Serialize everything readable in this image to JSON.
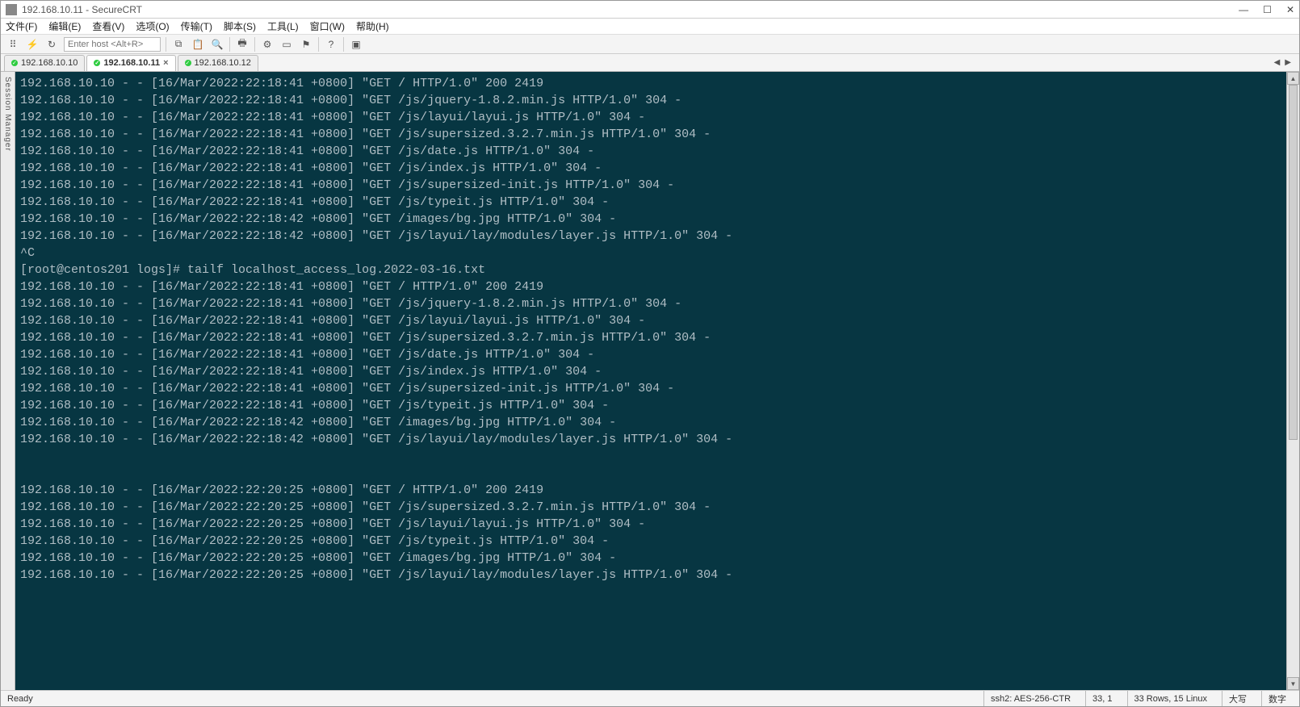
{
  "window": {
    "title": "192.168.10.11 - SecureCRT"
  },
  "menu": {
    "file": "文件(F)",
    "edit": "编辑(E)",
    "view": "查看(V)",
    "options": "选项(O)",
    "transfer": "传输(T)",
    "script": "脚本(S)",
    "tools": "工具(L)",
    "window": "窗口(W)",
    "help": "帮助(H)"
  },
  "toolbar": {
    "host_placeholder": "Enter host <Alt+R>"
  },
  "side_rail": {
    "label": "Session Manager"
  },
  "tabs": [
    {
      "label": "192.168.10.10",
      "active": false,
      "closeable": false
    },
    {
      "label": "192.168.10.11",
      "active": true,
      "closeable": true
    },
    {
      "label": "192.168.10.12",
      "active": false,
      "closeable": false
    }
  ],
  "terminal_lines": [
    "192.168.10.10 - - [16/Mar/2022:22:18:41 +0800] \"GET / HTTP/1.0\" 200 2419",
    "192.168.10.10 - - [16/Mar/2022:22:18:41 +0800] \"GET /js/jquery-1.8.2.min.js HTTP/1.0\" 304 -",
    "192.168.10.10 - - [16/Mar/2022:22:18:41 +0800] \"GET /js/layui/layui.js HTTP/1.0\" 304 -",
    "192.168.10.10 - - [16/Mar/2022:22:18:41 +0800] \"GET /js/supersized.3.2.7.min.js HTTP/1.0\" 304 -",
    "192.168.10.10 - - [16/Mar/2022:22:18:41 +0800] \"GET /js/date.js HTTP/1.0\" 304 -",
    "192.168.10.10 - - [16/Mar/2022:22:18:41 +0800] \"GET /js/index.js HTTP/1.0\" 304 -",
    "192.168.10.10 - - [16/Mar/2022:22:18:41 +0800] \"GET /js/supersized-init.js HTTP/1.0\" 304 -",
    "192.168.10.10 - - [16/Mar/2022:22:18:41 +0800] \"GET /js/typeit.js HTTP/1.0\" 304 -",
    "192.168.10.10 - - [16/Mar/2022:22:18:42 +0800] \"GET /images/bg.jpg HTTP/1.0\" 304 -",
    "192.168.10.10 - - [16/Mar/2022:22:18:42 +0800] \"GET /js/layui/lay/modules/layer.js HTTP/1.0\" 304 -",
    "^C",
    "[root@centos201 logs]# tailf localhost_access_log.2022-03-16.txt",
    "192.168.10.10 - - [16/Mar/2022:22:18:41 +0800] \"GET / HTTP/1.0\" 200 2419",
    "192.168.10.10 - - [16/Mar/2022:22:18:41 +0800] \"GET /js/jquery-1.8.2.min.js HTTP/1.0\" 304 -",
    "192.168.10.10 - - [16/Mar/2022:22:18:41 +0800] \"GET /js/layui/layui.js HTTP/1.0\" 304 -",
    "192.168.10.10 - - [16/Mar/2022:22:18:41 +0800] \"GET /js/supersized.3.2.7.min.js HTTP/1.0\" 304 -",
    "192.168.10.10 - - [16/Mar/2022:22:18:41 +0800] \"GET /js/date.js HTTP/1.0\" 304 -",
    "192.168.10.10 - - [16/Mar/2022:22:18:41 +0800] \"GET /js/index.js HTTP/1.0\" 304 -",
    "192.168.10.10 - - [16/Mar/2022:22:18:41 +0800] \"GET /js/supersized-init.js HTTP/1.0\" 304 -",
    "192.168.10.10 - - [16/Mar/2022:22:18:41 +0800] \"GET /js/typeit.js HTTP/1.0\" 304 -",
    "192.168.10.10 - - [16/Mar/2022:22:18:42 +0800] \"GET /images/bg.jpg HTTP/1.0\" 304 -",
    "192.168.10.10 - - [16/Mar/2022:22:18:42 +0800] \"GET /js/layui/lay/modules/layer.js HTTP/1.0\" 304 -",
    "",
    "",
    "192.168.10.10 - - [16/Mar/2022:22:20:25 +0800] \"GET / HTTP/1.0\" 200 2419",
    "192.168.10.10 - - [16/Mar/2022:22:20:25 +0800] \"GET /js/supersized.3.2.7.min.js HTTP/1.0\" 304 -",
    "192.168.10.10 - - [16/Mar/2022:22:20:25 +0800] \"GET /js/layui/layui.js HTTP/1.0\" 304 -",
    "192.168.10.10 - - [16/Mar/2022:22:20:25 +0800] \"GET /js/typeit.js HTTP/1.0\" 304 -",
    "192.168.10.10 - - [16/Mar/2022:22:20:25 +0800] \"GET /images/bg.jpg HTTP/1.0\" 304 -",
    "192.168.10.10 - - [16/Mar/2022:22:20:25 +0800] \"GET /js/layui/lay/modules/layer.js HTTP/1.0\" 304 -"
  ],
  "status": {
    "ready": "Ready",
    "cipher": "ssh2: AES-256-CTR",
    "cursor": "33,   1",
    "rowscols": "33 Rows, 15 Linux",
    "caps": "大写",
    "num": "数字"
  }
}
